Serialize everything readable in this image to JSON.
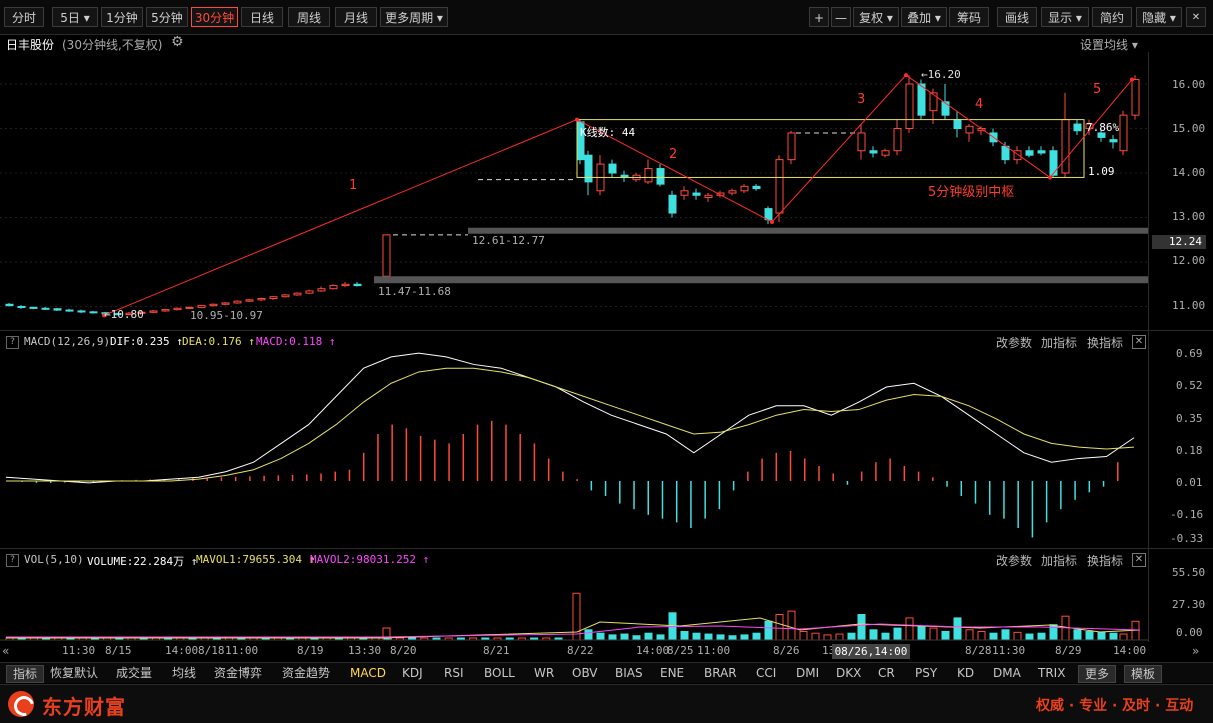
{
  "toolbar": {
    "left": [
      "分时",
      "5日",
      "1分钟",
      "5分钟",
      "30分钟",
      "日线",
      "周线",
      "月线",
      "更多周期"
    ],
    "active": "30分钟",
    "right": [
      "+",
      "—",
      "复权",
      "叠加",
      "筹码",
      "画线",
      "显示",
      "简约",
      "隐藏"
    ]
  },
  "stock": {
    "name": "日丰股份",
    "mode": "(30分钟线,不复权)",
    "setting": "设置均线"
  },
  "price_axis": [
    "16.00",
    "15.00",
    "14.00",
    "13.00",
    "12.00",
    "11.00"
  ],
  "current_price": "12.24",
  "annotations": {
    "high": "16.20",
    "low": "10.80",
    "box_count": "K线数: 44",
    "box_pct": "7.86%",
    "box_ratio": "1.09",
    "zone_label": "5分钟级别中枢",
    "gap1": "12.61-12.77",
    "gap2": "11.47-11.68",
    "gap3": "10.95-10.97",
    "waves": [
      "1",
      "2",
      "3",
      "4",
      "5"
    ]
  },
  "macd": {
    "title": "MACD(12,26,9)",
    "dif": "DIF:0.235",
    "dea": "DEA:0.176",
    "macd": "MACD:0.118",
    "axis": [
      "0.69",
      "0.52",
      "0.35",
      "0.18",
      "0.01",
      "-0.16",
      "-0.33"
    ],
    "links": [
      "改参数",
      "加指标",
      "换指标"
    ]
  },
  "vol": {
    "title": "VOL(5,10)",
    "volume": "VOLUME:22.284万",
    "mavol1": "MAVOL1:79655.304",
    "mavol2": "MAVOL2:98031.252",
    "axis": [
      "55.50",
      "27.30",
      "0.00"
    ],
    "links": [
      "改参数",
      "加指标",
      "换指标"
    ]
  },
  "time_axis": [
    "11:30",
    "8/15",
    "14:00",
    "8/18",
    "11:00",
    "8/19",
    "13:30",
    "8/20",
    "8/21",
    "8/22",
    "14:00",
    "8/25",
    "11:00",
    "8/26",
    "13:",
    "8/28",
    "11:30",
    "8/29",
    "14:00"
  ],
  "crosshair_time": "08/26,14:00",
  "indicators": [
    "指标",
    "恢复默认",
    "成交量",
    "均线",
    "资金博弈",
    "资金趋势",
    "MACD",
    "KDJ",
    "RSI",
    "BOLL",
    "WR",
    "OBV",
    "BIAS",
    "ENE",
    "BRAR",
    "CCI",
    "DMI",
    "DKX",
    "CR",
    "PSY",
    "KD",
    "DMA",
    "TRIX",
    "更多",
    "模板"
  ],
  "selected_indicator": "MACD",
  "footer": {
    "brand": "东方财富",
    "slogan": "权威 · 专业 · 及时 · 互动"
  },
  "colors": {
    "up": "#ff4a3a",
    "down": "#3fe0e0",
    "dif": "#ffffff",
    "dea": "#e8e060",
    "macd": "#ff44ff"
  }
}
